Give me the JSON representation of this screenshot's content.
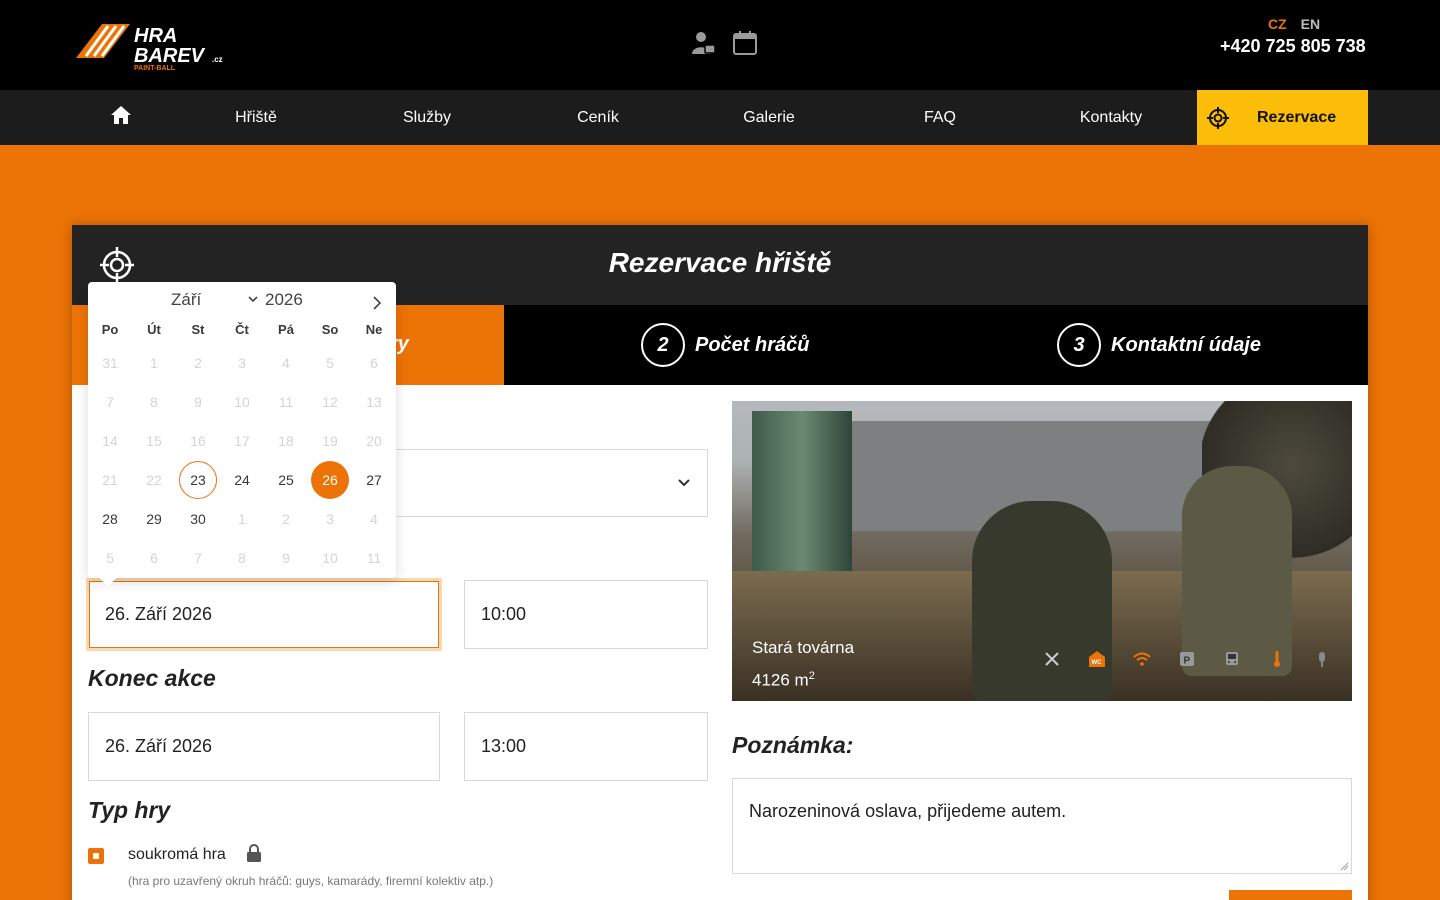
{
  "brand": {
    "logo_text": "HRA BAREV.cz PAINT-BALL",
    "accent": "#ec7306",
    "yellow": "#fbbd08"
  },
  "header": {
    "lang_cz": "CZ",
    "lang_en": "EN",
    "phone": "+420 725 805 738"
  },
  "nav": {
    "items": [
      "Hřiště",
      "Služby",
      "Ceník",
      "Galerie",
      "FAQ",
      "Kontakty"
    ],
    "reservation": "Rezervace"
  },
  "card": {
    "title": "Rezervace hřiště",
    "step1_partial": "ry",
    "step2_num": "2",
    "step2": "Počet hráčů",
    "step3_num": "3",
    "step3": "Kontaktní údaje"
  },
  "form": {
    "start_date": "26. Září 2026",
    "start_time": "10:00",
    "end_label": "Konec akce",
    "end_date": "26. Září 2026",
    "end_time": "13:00",
    "type_label": "Typ hry",
    "private_label": "soukromá hra",
    "private_help": "(hra pro uzavřený okruh hráčů: guys, kamarády, firemní kolektiv atp.)"
  },
  "venue": {
    "name": "Stará továrna",
    "area": "4126 m",
    "area_sup": "2",
    "amenities": [
      "food-icon",
      "wc-icon",
      "wifi-icon",
      "parking-icon",
      "bus-icon",
      "heating-icon",
      "microphone-icon"
    ]
  },
  "note": {
    "label": "Poznámka:",
    "value": "Narozeninová oslava, přijedeme autem."
  },
  "calendar": {
    "month": "Září",
    "year": "2026",
    "weekdays": [
      "Po",
      "Út",
      "St",
      "Čt",
      "Pá",
      "So",
      "Ne"
    ],
    "weeks": [
      [
        "31",
        "1",
        "2",
        "3",
        "4",
        "5",
        "6"
      ],
      [
        "7",
        "8",
        "9",
        "10",
        "11",
        "12",
        "13"
      ],
      [
        "14",
        "15",
        "16",
        "17",
        "18",
        "19",
        "20"
      ],
      [
        "21",
        "22",
        "23",
        "24",
        "25",
        "26",
        "27"
      ],
      [
        "28",
        "29",
        "30",
        "1",
        "2",
        "3",
        "4"
      ],
      [
        "5",
        "6",
        "7",
        "8",
        "9",
        "10",
        "11"
      ]
    ],
    "dim": [
      [
        1,
        1,
        1,
        1,
        1,
        1,
        1
      ],
      [
        1,
        1,
        1,
        1,
        1,
        1,
        1
      ],
      [
        1,
        1,
        1,
        1,
        1,
        1,
        1
      ],
      [
        1,
        1,
        0,
        0,
        0,
        0,
        0
      ],
      [
        0,
        0,
        0,
        1,
        1,
        1,
        1
      ],
      [
        1,
        1,
        1,
        1,
        1,
        1,
        1
      ]
    ],
    "today": "23",
    "selected": "26"
  }
}
